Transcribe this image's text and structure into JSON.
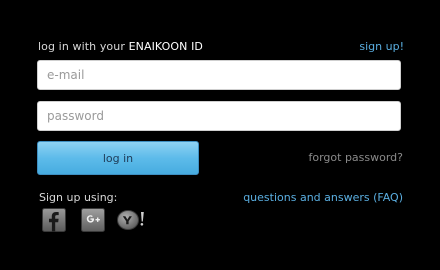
{
  "header": {
    "prefix": "log in with your ",
    "brand": "ENAIKOON ID",
    "signup_link": "sign up!"
  },
  "form": {
    "email_placeholder": "e-mail",
    "password_placeholder": "password",
    "login_button": "log in",
    "forgot_link": "forgot password?"
  },
  "footer": {
    "signup_using": "Sign up using:",
    "faq_link": "questions and answers (FAQ)",
    "social_icons": [
      "facebook-icon",
      "google-plus-icon",
      "yahoo-icon"
    ]
  },
  "colors": {
    "background": "#000000",
    "link": "#5aaee0",
    "button": "#5dbbea",
    "muted_link": "#8a8a8a"
  }
}
